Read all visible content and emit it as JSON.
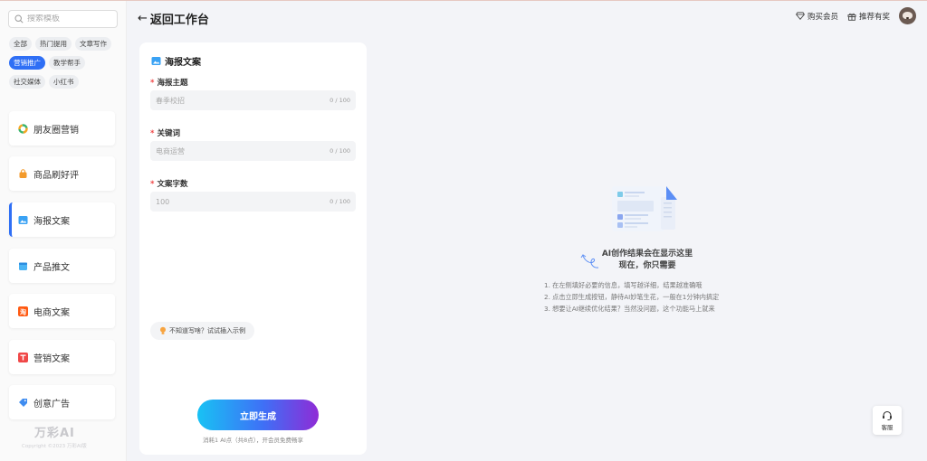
{
  "sidebar": {
    "search_placeholder": "搜索模板",
    "tags": [
      "全部",
      "热门提用",
      "文章写作",
      "营销推广",
      "教学帮手",
      "社交媒体",
      "小红书"
    ],
    "active_tag": "营销推广",
    "categories": [
      {
        "label": "朋友圈营销",
        "icon": "circle-colorful-icon"
      },
      {
        "label": "商品刷好评",
        "icon": "shopping-bag-icon"
      },
      {
        "label": "海报文案",
        "icon": "image-icon"
      },
      {
        "label": "产品推文",
        "icon": "calendar-icon"
      },
      {
        "label": "电商文案",
        "icon": "taobao-icon"
      },
      {
        "label": "营销文案",
        "icon": "marketing-icon"
      },
      {
        "label": "创意广告",
        "icon": "tag-icon"
      }
    ],
    "active_category": "海报文案",
    "brand": "万彩AI",
    "copyright": "Copyright ©2023 万彩AI版"
  },
  "header": {
    "back_label": "返回工作台",
    "buy_vip": "购买会员",
    "recommend": "推荐有奖"
  },
  "form": {
    "title": "海报文案",
    "fields": [
      {
        "label": "海报主题",
        "placeholder": "春季校招",
        "count": "0 / 100"
      },
      {
        "label": "关键词",
        "placeholder": "电商运营",
        "count": "0 / 100"
      },
      {
        "label": "文案字数",
        "placeholder": "100",
        "count": "0 / 100"
      }
    ],
    "example_label": "不知道写啥？试试插入示例",
    "generate_label": "立即生成",
    "cost_text": "消耗1 AI点（共8点），开会员免费畅享"
  },
  "empty_state": {
    "title_line1": "AI创作结果会在显示这里",
    "title_line2": "现在，你只需要",
    "tips": [
      "1. 在左侧填好必要的信息，填写越详细，结果越准确哦",
      "2. 点击立即生成按钮，静待AI妙笔生花，一般在1分钟内搞定",
      "3. 想要让AI继续优化结果？当然没问题，这个功能马上就来"
    ]
  },
  "service": {
    "label": "客服"
  },
  "colors": {
    "accent": "#2f6ff5",
    "required": "#f04848",
    "gradient_start": "#18c2f4",
    "gradient_end": "#8f2bd6"
  }
}
